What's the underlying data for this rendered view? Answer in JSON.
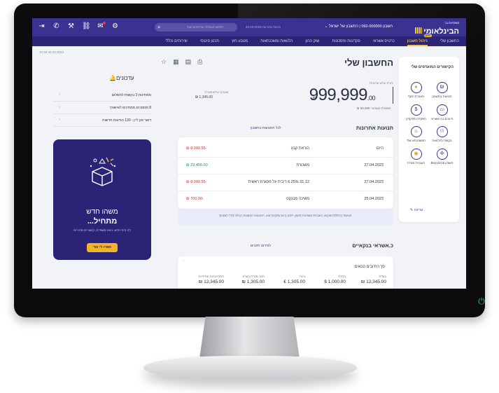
{
  "header": {
    "logo_small": "משקיעים בך",
    "logo_main": "הבינלאומי",
    "account_selector": "חשבון 092-000000 | החשבון של ישראל ⌄",
    "last_login": "כניסה אחרונה 22.03.2023",
    "search_placeholder": "חיפוש פעולות, שירותים ועוד",
    "icons": [
      "logout-icon",
      "phone-icon",
      "tools-icon",
      "link-icon",
      "mail-icon",
      "settings-icon"
    ]
  },
  "nav": {
    "items": [
      {
        "label": "החשבון שלי",
        "active": false
      },
      {
        "label": "ניהול חשבון",
        "active": true
      },
      {
        "label": "כרטיס אשראי",
        "active": false
      },
      {
        "label": "פקדונות וחסכונות",
        "active": false
      },
      {
        "label": "שוק ההון",
        "active": false
      },
      {
        "label": "הלוואות ומשכנתאות",
        "active": false
      },
      {
        "label": "מטבע חוץ",
        "active": false
      },
      {
        "label": "תכנון פיננסי",
        "active": false
      },
      {
        "label": "שירותים וכללי",
        "active": false
      }
    ],
    "badge": "חדש"
  },
  "datetime": "10:48  26.03.2023",
  "quick_actions": {
    "title": "הקישורים המועדפים שלי",
    "items": [
      {
        "icon": "shekel-icon",
        "label": "תנועות בחשבון"
      },
      {
        "icon": "coin-icon",
        "label": "העברת כסף"
      },
      {
        "icon": "card-icon",
        "label": "חיובים בכ.אשראי"
      },
      {
        "icon": "deposit-icon",
        "label": "הפקדה לפיקדון"
      },
      {
        "icon": "loan-icon",
        "label": "בקשה להלוואה"
      },
      {
        "icon": "mortgage-icon",
        "label": "המשכנתא שלי"
      },
      {
        "icon": "beyond-icon",
        "label": "חשבון & Beyond"
      },
      {
        "icon": "transfer-icon",
        "label": "העברת מט\"ח"
      }
    ],
    "edit": "עריכה ✎"
  },
  "account": {
    "title": "החשבון שלי",
    "balance_label": "יתרת עו\"ש עדכנית",
    "balance_main": "999,999",
    "balance_decimals": ".00",
    "currency": "₪",
    "credit_line": "מסגרת אשראי: 99,999 ₪",
    "pending_label": "שערוך עו\"ש מט\"ח",
    "pending_amount": "1,345.00 ₪"
  },
  "transactions": {
    "title": "תנועות אחרונות",
    "link": "לכל התנועות בחשבון",
    "rows": [
      {
        "date": "היום",
        "desc": "הוראת קבע",
        "amount": "-8,000.55 ₪",
        "negative": true
      },
      {
        "date": "27.04.2023",
        "desc": "משכורת",
        "amount": "23,456.00 ₪",
        "negative": false
      },
      {
        "date": "27.04.2023",
        "desc": "31.12 6.25% ריבית על מסגרת ראשית",
        "amount": "-8,000.55 ₪",
        "negative": true
      },
      {
        "date": "25.04.2023",
        "desc": "משיכה מבנקט",
        "amount": "-700.00 ₪",
        "negative": true
      }
    ],
    "note": "תנועות הכוללות שיקים, העברות ומשיכות מזומן ייתכנו ביום עסקים הבא. התנועות המוצגות הן לפי סדר הזמנים"
  },
  "credit": {
    "title": "כ.אשראי בנקאיים",
    "link": "לפירוט חיובים",
    "next_label": "סך החיובים הבאים:",
    "columns": [
      {
        "label": "בש\"ח",
        "value": "12,345.00 ₪"
      },
      {
        "label": "בדולר",
        "value": "1,000.00 $"
      },
      {
        "label": "ביורו",
        "value": "1,305.00 €"
      },
      {
        "label": "חיוב מט\"ח בש\"ח",
        "value": "1,305.00 ₪"
      },
      {
        "label": "התחייבויות עתידיות",
        "value": "12,345.00 ₪"
      }
    ]
  },
  "updates": {
    "title": "עדכונים",
    "items": [
      "ממתינות 3 בקשות לתשלום",
      "8 מסמכים ממתינים לאישורך",
      "דואר און ליין - 130 הודעות חדשות"
    ]
  },
  "promo": {
    "title1": "משהו חדש",
    "title2": "מתחיל...",
    "text": "דף בית חדש, ניווט משודרג, קישורים מהירים",
    "button": "ספרו לי עוד"
  },
  "colors": {
    "brand_purple": "#3a3191",
    "nav_dark": "#2a2376",
    "accent_gold": "#f0c33b",
    "negative_red": "#d02f2f",
    "positive_green": "#1f8a5b"
  }
}
